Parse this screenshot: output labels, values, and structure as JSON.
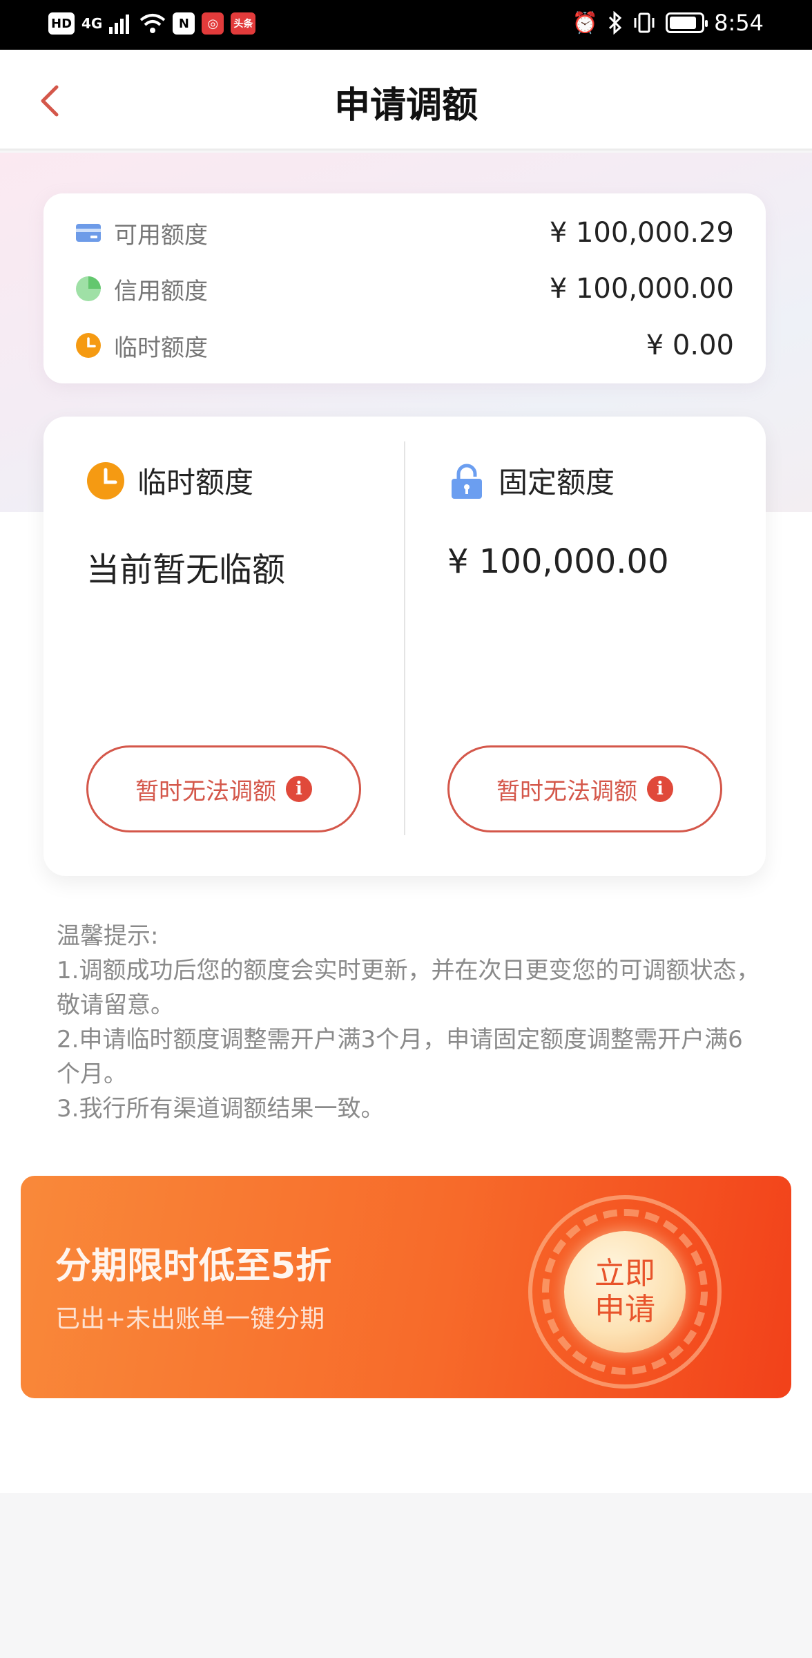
{
  "status_bar": {
    "left_badges": [
      "HD",
      "4G",
      "N",
      "头条"
    ],
    "time": "8:54",
    "battery_level": 0.75
  },
  "nav": {
    "title": "申请调额"
  },
  "summary": {
    "rows": [
      {
        "icon": "card-icon",
        "label": "可用额度",
        "value": "¥ 100,000.29"
      },
      {
        "icon": "pie-icon",
        "label": "信用额度",
        "value": "¥ 100,000.00"
      },
      {
        "icon": "clock-icon",
        "label": "临时额度",
        "value": "¥ 0.00"
      }
    ]
  },
  "quota": {
    "temporary": {
      "title": "临时额度",
      "value": "当前暂无临额",
      "button": "暂时无法调额"
    },
    "fixed": {
      "title": "固定额度",
      "value": "¥ 100,000.00",
      "button": "暂时无法调额"
    }
  },
  "tips": {
    "heading": "温馨提示:",
    "lines": [
      "1.调额成功后您的额度会实时更新，并在次日更变您的可调额状态，敬请留意。",
      "2.申请临时额度调整需开户满3个月，申请固定额度调整需开户满6个月。",
      "3.我行所有渠道调额结果一致。"
    ]
  },
  "banner": {
    "title": "分期限时低至5折",
    "subtitle": "已出+未出账单一键分期",
    "button_line1": "立即",
    "button_line2": "申请"
  },
  "colors": {
    "accent": "#d4574a",
    "banner_start": "#f9893a",
    "banner_end": "#f2411a"
  }
}
